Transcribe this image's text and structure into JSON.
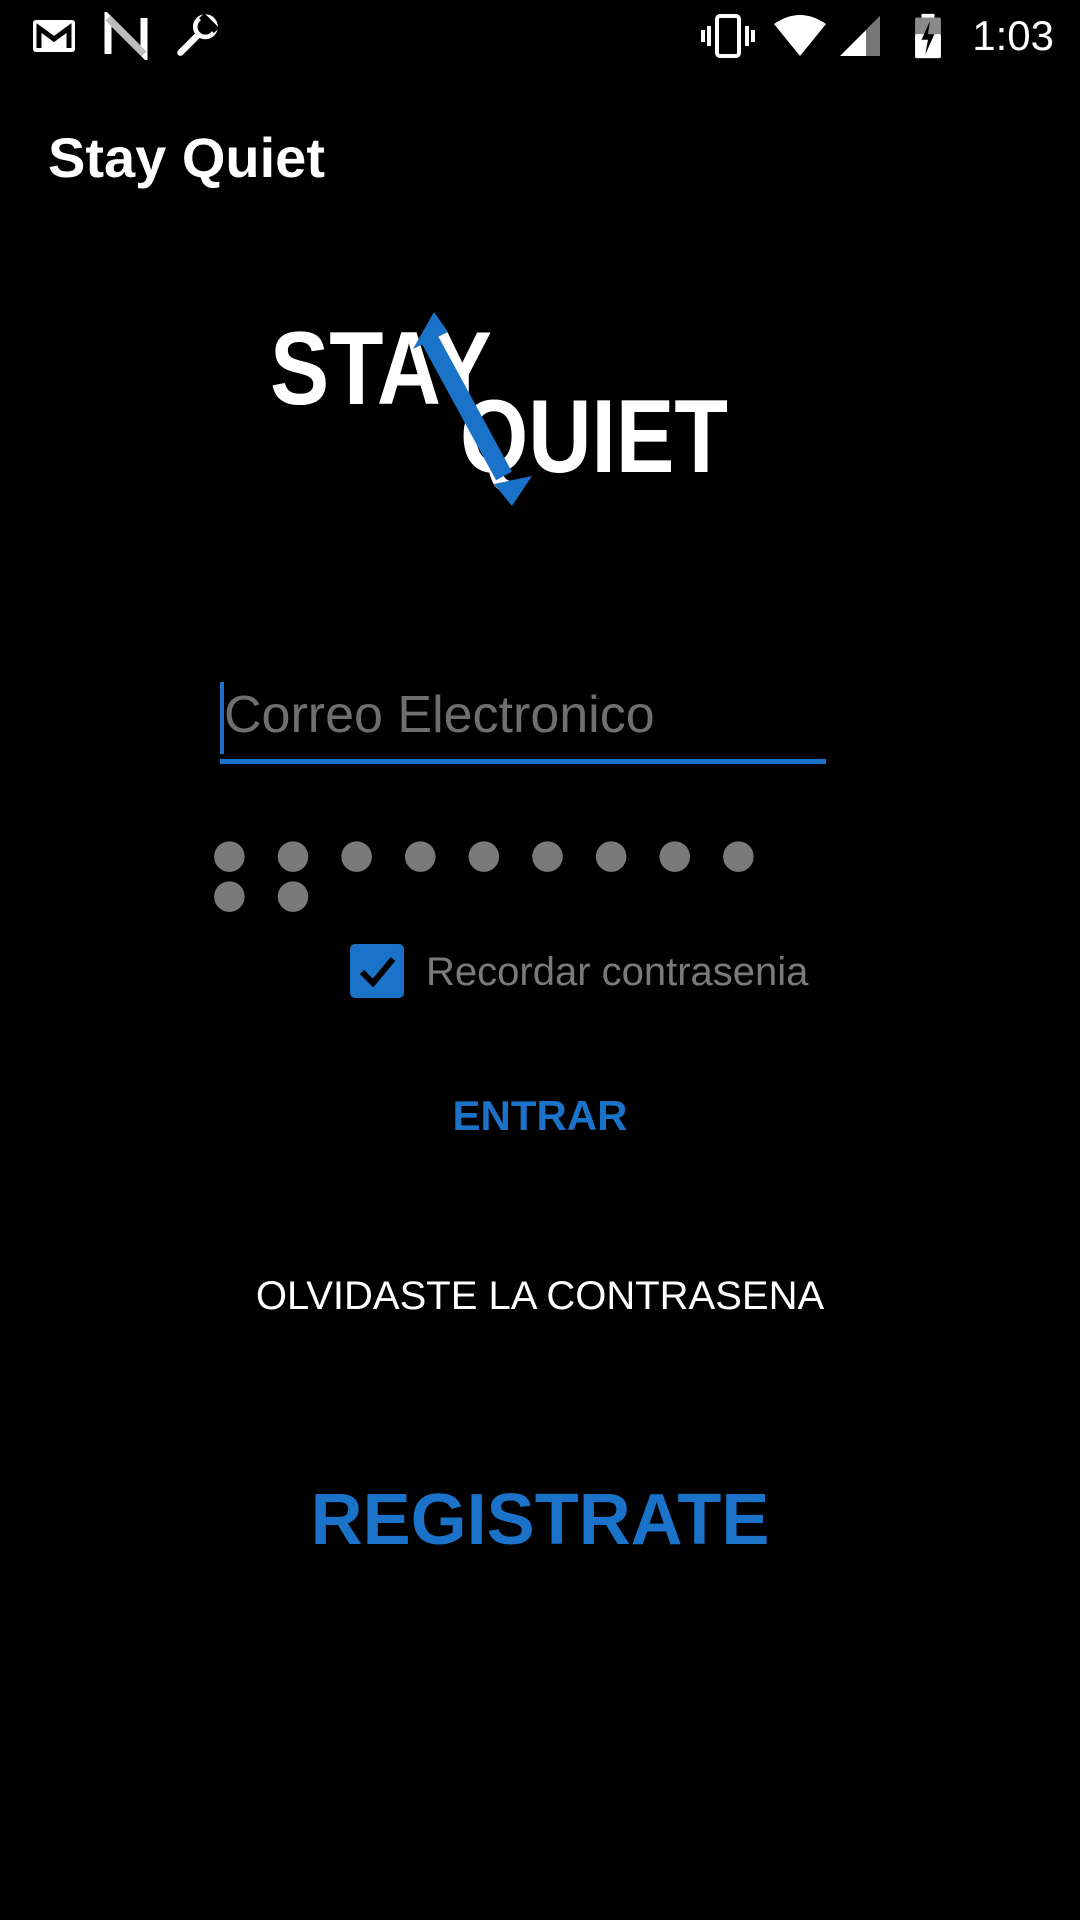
{
  "status_bar": {
    "time": "1:03",
    "icons_left": [
      "gmail-icon",
      "n-notification-icon",
      "wrench-icon"
    ],
    "icons_right": [
      "vibrate-icon",
      "wifi-icon",
      "signal-icon",
      "battery-charging-icon"
    ]
  },
  "app_bar": {
    "title": "Stay Quiet"
  },
  "logo": {
    "word1": "STAY",
    "word2": "QUIET",
    "accent_color": "#1a73c8"
  },
  "login_form": {
    "email_placeholder": "Correo Electronico",
    "email_value": "",
    "password_masked": "● ● ● ● ● ● ● ● ● ● ●",
    "remember_label": "Recordar contrasenia",
    "remember_checked": true
  },
  "actions": {
    "login_label": "ENTRAR",
    "forgot_label": "OLVIDASTE LA CONTRASENA",
    "register_label": "REGISTRATE"
  },
  "colors": {
    "background": "#000000",
    "accent": "#1a73c8",
    "hint_text": "#6f6f6f"
  }
}
